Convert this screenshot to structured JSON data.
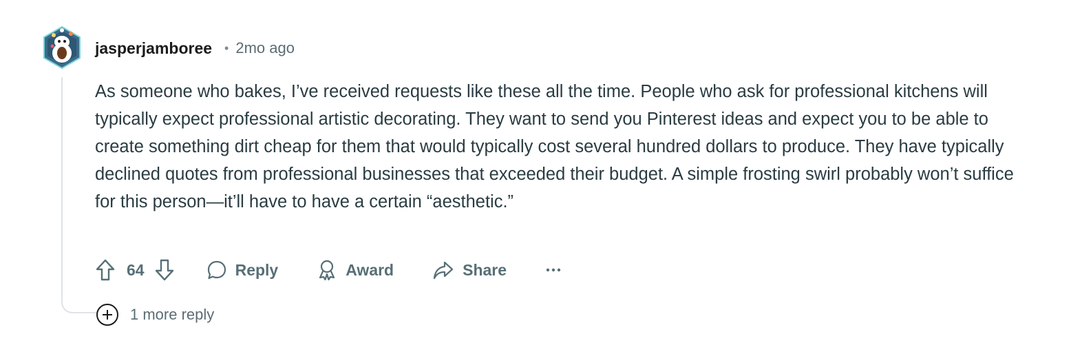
{
  "comment": {
    "author": "jasperjamboree",
    "separator": "•",
    "timestamp": "2mo ago",
    "body": "As someone who bakes, I’ve received requests like these all the time. People who ask for professional kitchens will typically expect professional artistic decorating. They want to send you Pinterest ideas and expect you to be able to create something dirt cheap for them that would typically cost several hundred dollars to produce. They have typically declined quotes from professional businesses that exceeded their budget. A simple frosting swirl probably won’t suffice for this person—it’ll have to have a certain “aesthetic.”",
    "avatar_icon": "snoo-avatar-icon"
  },
  "actions": {
    "upvote_icon": "upvote-arrow-icon",
    "score": "64",
    "downvote_icon": "downvote-arrow-icon",
    "reply_label": "Reply",
    "award_label": "Award",
    "share_label": "Share",
    "more_icon": "ellipsis-icon"
  },
  "replies": {
    "more_label": "1 more reply",
    "expand_icon": "plus-circle-icon"
  },
  "colors": {
    "text": "#2a3c42",
    "muted": "#576f76",
    "thread_line": "#dfe3e6",
    "avatar_bg": "#3b6b8a"
  }
}
